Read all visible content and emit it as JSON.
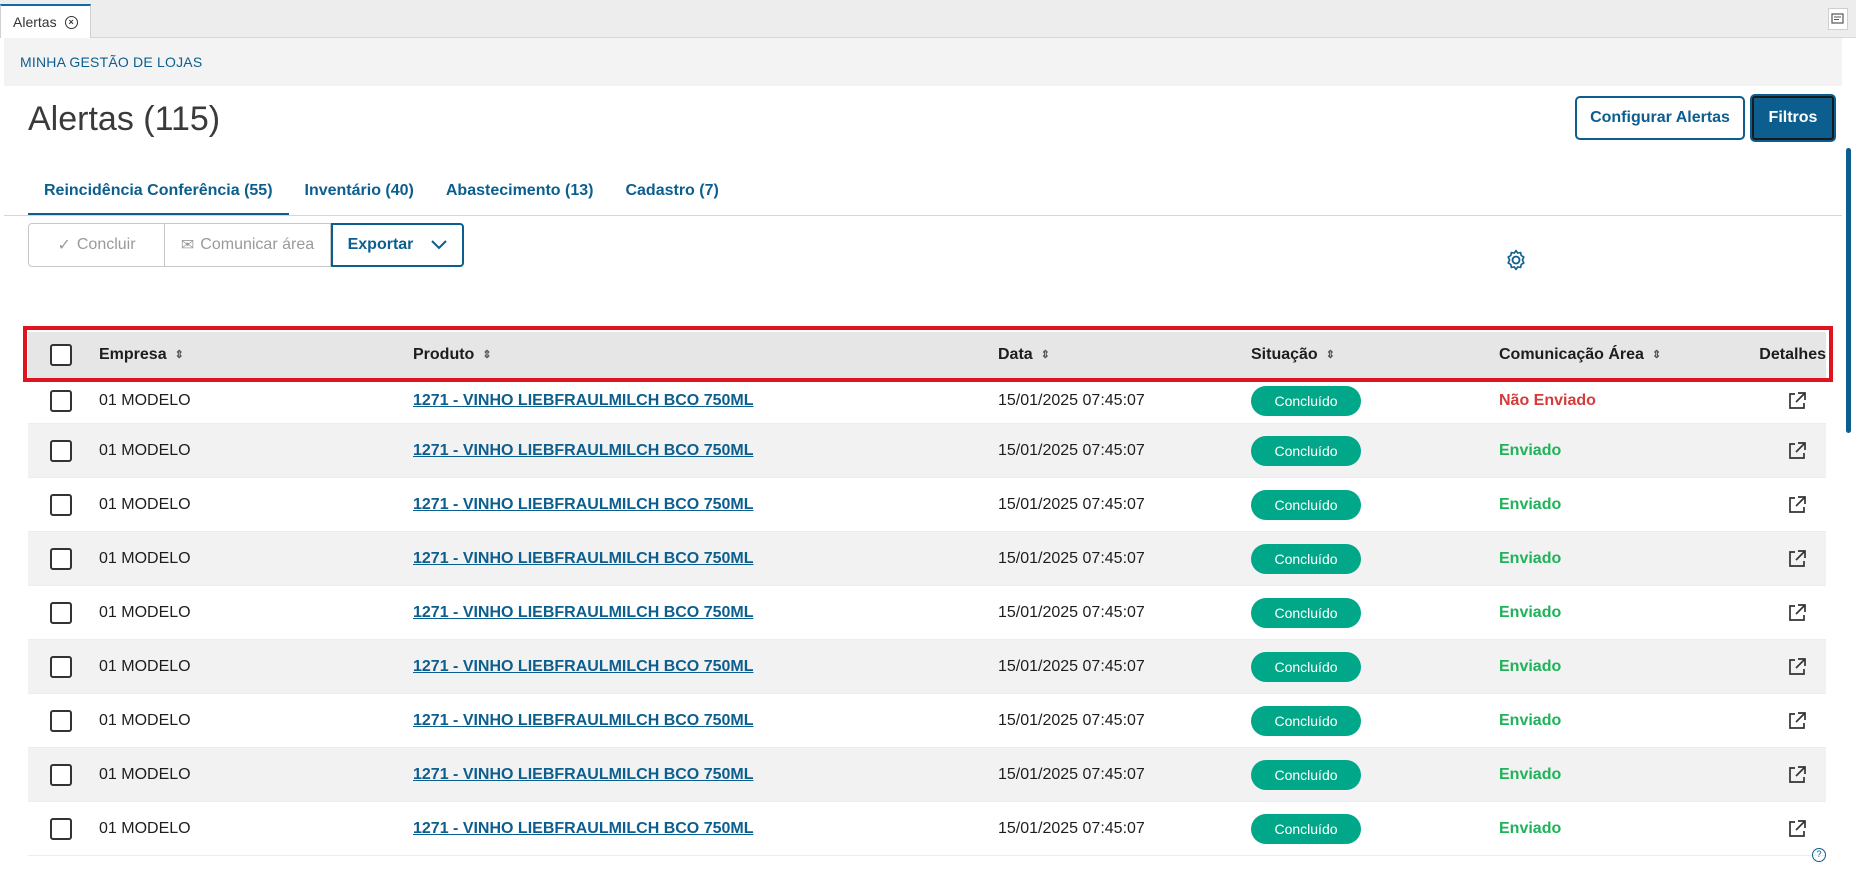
{
  "window": {
    "tab_label": "Alertas",
    "close_icon": "close-circle-icon"
  },
  "breadcrumb": "MINHA GESTÃO DE LOJAS",
  "header": {
    "title": "Alertas (115)",
    "configure_button": "Configurar Alertas",
    "filters_button": "Filtros"
  },
  "tabs": [
    {
      "label": "Reincidência Conferência (55)",
      "active": true
    },
    {
      "label": "Inventário (40)",
      "active": false
    },
    {
      "label": "Abastecimento (13)",
      "active": false
    },
    {
      "label": "Cadastro (7)",
      "active": false
    }
  ],
  "actions": {
    "concluir": "Concluir",
    "comunicar": "Comunicar área",
    "exportar": "Exportar"
  },
  "table": {
    "columns": {
      "empresa": "Empresa",
      "produto": "Produto",
      "data": "Data",
      "situacao": "Situação",
      "comunicacao": "Comunicação Área",
      "detalhes": "Detalhes"
    },
    "rows": [
      {
        "empresa": "01 MODELO",
        "produto": "1271 - VINHO LIEBFRAULMILCH BCO 750ML",
        "data": "15/01/2025 07:45:07",
        "situacao": "Concluído",
        "comunicacao": "Não Enviado"
      },
      {
        "empresa": "01 MODELO",
        "produto": "1271 - VINHO LIEBFRAULMILCH BCO 750ML",
        "data": "15/01/2025 07:45:07",
        "situacao": "Concluído",
        "comunicacao": "Enviado"
      },
      {
        "empresa": "01 MODELO",
        "produto": "1271 - VINHO LIEBFRAULMILCH BCO 750ML",
        "data": "15/01/2025 07:45:07",
        "situacao": "Concluído",
        "comunicacao": "Enviado"
      },
      {
        "empresa": "01 MODELO",
        "produto": "1271 - VINHO LIEBFRAULMILCH BCO 750ML",
        "data": "15/01/2025 07:45:07",
        "situacao": "Concluído",
        "comunicacao": "Enviado"
      },
      {
        "empresa": "01 MODELO",
        "produto": "1271 - VINHO LIEBFRAULMILCH BCO 750ML",
        "data": "15/01/2025 07:45:07",
        "situacao": "Concluído",
        "comunicacao": "Enviado"
      },
      {
        "empresa": "01 MODELO",
        "produto": "1271 - VINHO LIEBFRAULMILCH BCO 750ML",
        "data": "15/01/2025 07:45:07",
        "situacao": "Concluído",
        "comunicacao": "Enviado"
      },
      {
        "empresa": "01 MODELO",
        "produto": "1271 - VINHO LIEBFRAULMILCH BCO 750ML",
        "data": "15/01/2025 07:45:07",
        "situacao": "Concluído",
        "comunicacao": "Enviado"
      },
      {
        "empresa": "01 MODELO",
        "produto": "1271 - VINHO LIEBFRAULMILCH BCO 750ML",
        "data": "15/01/2025 07:45:07",
        "situacao": "Concluído",
        "comunicacao": "Enviado"
      },
      {
        "empresa": "01 MODELO",
        "produto": "1271 - VINHO LIEBFRAULMILCH BCO 750ML",
        "data": "15/01/2025 07:45:07",
        "situacao": "Concluído",
        "comunicacao": "Enviado"
      }
    ]
  },
  "colors": {
    "primary": "#0c5e8f",
    "status_badge": "#00a889",
    "sent": "#1fb25a",
    "not_sent": "#d63b3b",
    "highlight": "#e0141e"
  },
  "icons": {
    "settings": "gear-icon",
    "details": "external-link-icon",
    "sort": "sort-icon",
    "dropdown": "chevron-down-icon",
    "concluir": "check-icon",
    "comunicar": "mail-icon"
  }
}
